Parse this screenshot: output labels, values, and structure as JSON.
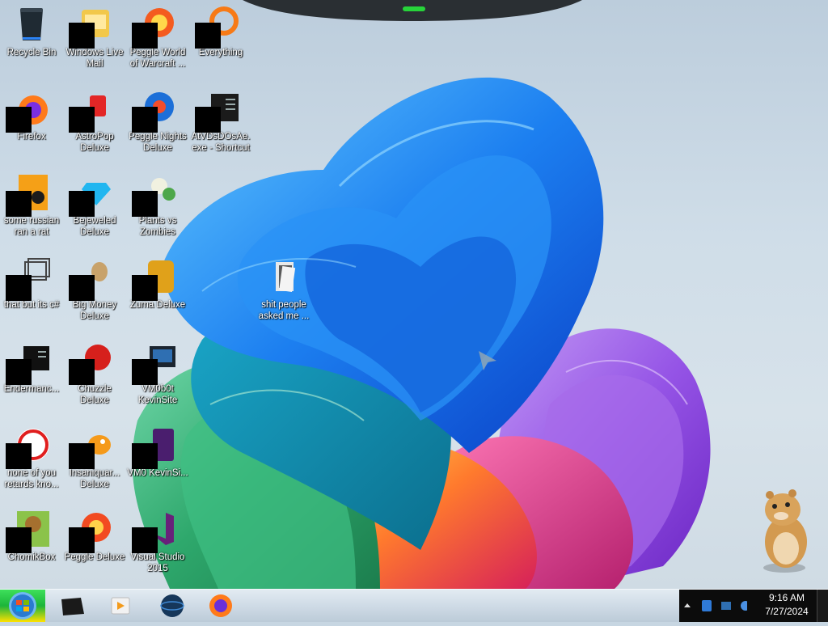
{
  "desktop": {
    "icons": [
      {
        "label": "Recycle Bin",
        "icon": "recycle-bin-icon",
        "censored": false
      },
      {
        "label": "Windows Live Mail",
        "icon": "mail-icon",
        "censored": true
      },
      {
        "label": "Peggle World of Warcraft ...",
        "icon": "peggle-wow-icon",
        "censored": true
      },
      {
        "label": "Everything",
        "icon": "everything-search-icon",
        "censored": true
      },
      {
        "label": "Firefox",
        "icon": "firefox-icon",
        "censored": true
      },
      {
        "label": "AstroPop Deluxe",
        "icon": "astropop-icon",
        "censored": true
      },
      {
        "label": "Peggle Nights Deluxe",
        "icon": "peggle-nights-icon",
        "censored": true
      },
      {
        "label": "AtVDsDOsAe.exe - Shortcut",
        "icon": "exe-shortcut-icon",
        "censored": true
      },
      {
        "label": "some russian ran a rat",
        "icon": "orange-app-icon",
        "censored": true
      },
      {
        "label": "Bejeweled Deluxe",
        "icon": "bejeweled-icon",
        "censored": true
      },
      {
        "label": "Plants vs Zombies",
        "icon": "plants-vs-zombies-icon",
        "censored": true
      },
      {
        "label": "that but its c#",
        "icon": "window-stack-icon",
        "censored": true
      },
      {
        "label": "Big Money Deluxe",
        "icon": "money-bag-icon",
        "censored": true
      },
      {
        "label": "Zuma Deluxe",
        "icon": "zuma-icon",
        "censored": true
      },
      {
        "label": "Endermanc...",
        "icon": "terminal-icon",
        "censored": true
      },
      {
        "label": "Chuzzle Deluxe",
        "icon": "chuzzle-icon",
        "censored": true
      },
      {
        "label": "VM0b0t KevinSite",
        "icon": "vm-icon",
        "censored": true
      },
      {
        "label": "none of you retards kno...",
        "icon": "red-circle-app-icon",
        "censored": true
      },
      {
        "label": "Insaniquar... Deluxe",
        "icon": "insaniquarium-icon",
        "censored": true
      },
      {
        "label": "VM0 KevinSi...",
        "icon": "visual-studio-purple-icon",
        "censored": true
      },
      {
        "label": "ChomikBox",
        "icon": "chomikbox-icon",
        "censored": true
      },
      {
        "label": "Peggle Deluxe",
        "icon": "peggle-icon",
        "censored": true
      },
      {
        "label": "Visual Studio 2015",
        "icon": "visual-studio-icon",
        "censored": true
      },
      {
        "label": "shit people asked me ...",
        "icon": "folder-icon",
        "censored": false
      }
    ]
  },
  "taskbar": {
    "start": "start-orb-icon",
    "pinned": [
      {
        "name": "taskbar-app-1",
        "icon": "dark-app-icon"
      },
      {
        "name": "taskbar-app-2",
        "icon": "media-player-icon"
      },
      {
        "name": "taskbar-app-3",
        "icon": "globe-app-icon"
      },
      {
        "name": "taskbar-app-4",
        "icon": "firefox-icon"
      }
    ],
    "clock": {
      "time": "9:16 AM",
      "date": "7/27/2024"
    }
  }
}
